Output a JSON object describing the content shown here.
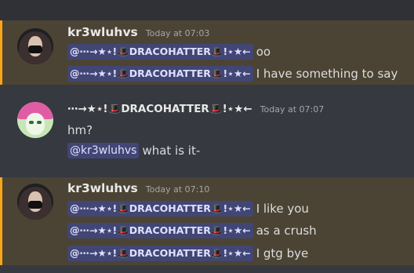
{
  "messages": [
    {
      "username": "kr3wluhvs",
      "timestamp": "Today at 07:03",
      "lines": [
        {
          "mention": "@⋯→★⋆!🎩DRACOHATTER🎩!⋆★←",
          "text": "oo"
        },
        {
          "mention": "@⋯→★⋆!🎩DRACOHATTER🎩!⋆★←",
          "text": "I have something to say"
        }
      ]
    },
    {
      "username": "⋯→★⋆!🎩DRACOHATTER🎩!⋆★←",
      "timestamp": "Today at 07:07",
      "lines": [
        {
          "text": "hm?"
        },
        {
          "mention": "@kr3wluhvs",
          "text": "what is it-"
        }
      ]
    },
    {
      "username": "kr3wluhvs",
      "timestamp": "Today at 07:10",
      "lines": [
        {
          "mention": "@⋯→★⋆!🎩DRACOHATTER🎩!⋆★←",
          "text": "I like you"
        },
        {
          "mention": "@⋯→★⋆!🎩DRACOHATTER🎩!⋆★←",
          "text": "as a crush"
        },
        {
          "mention": "@⋯→★⋆!🎩DRACOHATTER🎩!⋆★←",
          "text": "I gtg bye"
        }
      ]
    }
  ],
  "colors": {
    "background": "#36393f",
    "highlight_bg": "#4b4434",
    "highlight_bar": "#faa61a",
    "mention_bg": "#414675",
    "mention_text": "#dee0fc"
  },
  "icons": [
    "avatar-kr3wluhvs",
    "avatar-dracohatter",
    "top-hat-icon",
    "star-icon"
  ]
}
